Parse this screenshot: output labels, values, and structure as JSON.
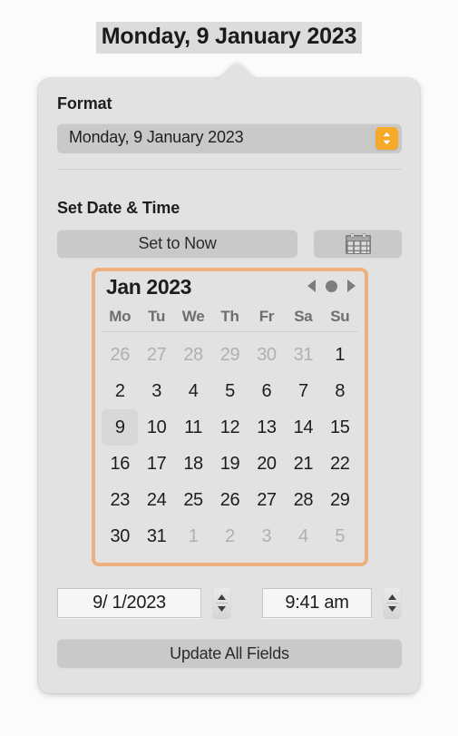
{
  "caption": {
    "title": "Monday, 9 January 2023"
  },
  "format_section": {
    "label": "Format",
    "popup": {
      "value": "Monday, 9 January 2023",
      "chevron_icon": "chevron-up-down-icon",
      "accent_color": "#f7a928"
    }
  },
  "set_datetime_section": {
    "label": "Set Date & Time",
    "set_to_now_label": "Set to Now",
    "calendar_toggle_icon": "calendar-icon"
  },
  "calendar": {
    "month_label": "Jan 2023",
    "focus_ring_color": "#edb07e",
    "nav": {
      "prev_icon": "triangle-left-icon",
      "today_icon": "dot-icon",
      "next_icon": "triangle-right-icon"
    },
    "weekdays": [
      "Mo",
      "Tu",
      "We",
      "Th",
      "Fr",
      "Sa",
      "Su"
    ],
    "weeks": [
      [
        {
          "day": "26",
          "muted": true,
          "selected": false
        },
        {
          "day": "27",
          "muted": true,
          "selected": false
        },
        {
          "day": "28",
          "muted": true,
          "selected": false
        },
        {
          "day": "29",
          "muted": true,
          "selected": false
        },
        {
          "day": "30",
          "muted": true,
          "selected": false
        },
        {
          "day": "31",
          "muted": true,
          "selected": false
        },
        {
          "day": "1",
          "muted": false,
          "selected": false
        }
      ],
      [
        {
          "day": "2",
          "muted": false,
          "selected": false
        },
        {
          "day": "3",
          "muted": false,
          "selected": false
        },
        {
          "day": "4",
          "muted": false,
          "selected": false
        },
        {
          "day": "5",
          "muted": false,
          "selected": false
        },
        {
          "day": "6",
          "muted": false,
          "selected": false
        },
        {
          "day": "7",
          "muted": false,
          "selected": false
        },
        {
          "day": "8",
          "muted": false,
          "selected": false
        }
      ],
      [
        {
          "day": "9",
          "muted": false,
          "selected": true
        },
        {
          "day": "10",
          "muted": false,
          "selected": false
        },
        {
          "day": "11",
          "muted": false,
          "selected": false
        },
        {
          "day": "12",
          "muted": false,
          "selected": false
        },
        {
          "day": "13",
          "muted": false,
          "selected": false
        },
        {
          "day": "14",
          "muted": false,
          "selected": false
        },
        {
          "day": "15",
          "muted": false,
          "selected": false
        }
      ],
      [
        {
          "day": "16",
          "muted": false,
          "selected": false
        },
        {
          "day": "17",
          "muted": false,
          "selected": false
        },
        {
          "day": "18",
          "muted": false,
          "selected": false
        },
        {
          "day": "19",
          "muted": false,
          "selected": false
        },
        {
          "day": "20",
          "muted": false,
          "selected": false
        },
        {
          "day": "21",
          "muted": false,
          "selected": false
        },
        {
          "day": "22",
          "muted": false,
          "selected": false
        }
      ],
      [
        {
          "day": "23",
          "muted": false,
          "selected": false
        },
        {
          "day": "24",
          "muted": false,
          "selected": false
        },
        {
          "day": "25",
          "muted": false,
          "selected": false
        },
        {
          "day": "26",
          "muted": false,
          "selected": false
        },
        {
          "day": "27",
          "muted": false,
          "selected": false
        },
        {
          "day": "28",
          "muted": false,
          "selected": false
        },
        {
          "day": "29",
          "muted": false,
          "selected": false
        }
      ],
      [
        {
          "day": "30",
          "muted": false,
          "selected": false
        },
        {
          "day": "31",
          "muted": false,
          "selected": false
        },
        {
          "day": "1",
          "muted": true,
          "selected": false
        },
        {
          "day": "2",
          "muted": true,
          "selected": false
        },
        {
          "day": "3",
          "muted": true,
          "selected": false
        },
        {
          "day": "4",
          "muted": true,
          "selected": false
        },
        {
          "day": "5",
          "muted": true,
          "selected": false
        }
      ]
    ]
  },
  "fields": {
    "date": {
      "value": "9/ 1/2023",
      "stepper_icon": "chevron-up-down-icon"
    },
    "time": {
      "value": "9:41 am",
      "stepper_icon": "chevron-up-down-icon"
    }
  },
  "update_button": {
    "label": "Update All Fields"
  }
}
